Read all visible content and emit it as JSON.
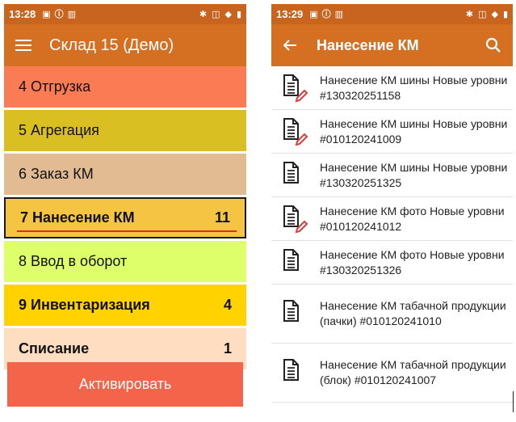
{
  "left": {
    "status": {
      "time": "13:28"
    },
    "appbar": {
      "title": "Склад 15 (Демо)"
    },
    "operations": [
      {
        "label": "4 Отгрузка",
        "count": "",
        "bold": false,
        "selected": false,
        "color": "#fa7b54"
      },
      {
        "label": "5 Агрегация",
        "count": "",
        "bold": false,
        "selected": false,
        "color": "#d9bf22"
      },
      {
        "label": "6 Заказ КМ",
        "count": "",
        "bold": false,
        "selected": false,
        "color": "#e2bb93"
      },
      {
        "label": "7 Нанесение КМ",
        "count": "11",
        "bold": true,
        "selected": true,
        "color": "#f4c442"
      },
      {
        "label": "8 Ввод в оборот",
        "count": "",
        "bold": false,
        "selected": false,
        "color": "#deff6a"
      },
      {
        "label": "9 Инвентаризация",
        "count": "4",
        "bold": true,
        "selected": false,
        "color": "#ffd200"
      },
      {
        "label": "Списание",
        "count": "1",
        "bold": true,
        "selected": false,
        "color": "#ffddc1"
      }
    ],
    "activate_label": "Активировать"
  },
  "right": {
    "status": {
      "time": "13:29"
    },
    "appbar": {
      "title": "Нанесение КМ"
    },
    "documents": [
      {
        "title": "Нанесение КМ шины Новые уровни #130320251158",
        "icon": "document-edit-icon"
      },
      {
        "title": "Нанесение КМ шины Новые уровни #010120241009",
        "icon": "document-edit-icon"
      },
      {
        "title": "Нанесение КМ шины Новые уровни #130320251325",
        "icon": "document-icon"
      },
      {
        "title": "Нанесение КМ фото Новые уровни #010120241012",
        "icon": "document-edit-icon"
      },
      {
        "title": "Нанесение КМ фото Новые уровни #130320251326",
        "icon": "document-icon"
      },
      {
        "title": "Нанесение КМ табачной продукции (пачки) #010120241010",
        "icon": "document-icon"
      },
      {
        "title": "Нанесение КМ табачной продукции (блок) #010120241007",
        "icon": "document-icon"
      }
    ]
  },
  "colors": {
    "statusbar": "#c8641e",
    "appbar": "#d56f22",
    "accent_red": "#e02b2b",
    "activate": "#f4644a"
  }
}
